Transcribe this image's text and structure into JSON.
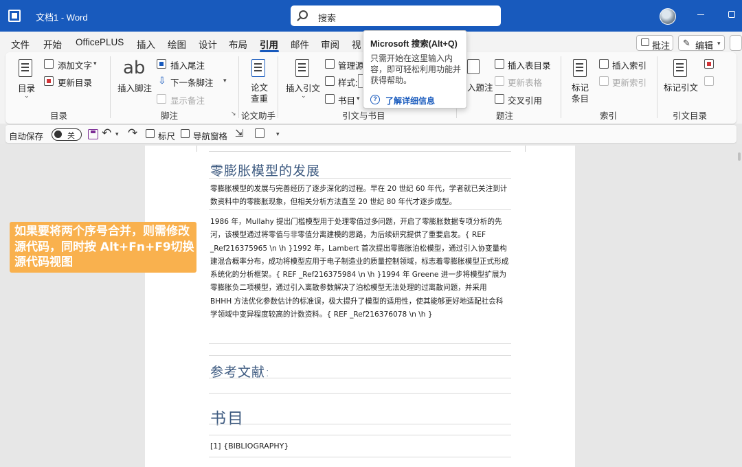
{
  "titlebar": {
    "doc_title": "文档1 - Word",
    "search_placeholder": "搜索"
  },
  "tabs": [
    "文件",
    "开始",
    "OfficePLUS",
    "插入",
    "绘图",
    "设计",
    "布局",
    "引用",
    "邮件",
    "审阅",
    "视"
  ],
  "active_tab": "引用",
  "header_buttons": {
    "comment": "批注",
    "edit": "编辑"
  },
  "ribbon": {
    "toc": {
      "big_label": "目录",
      "add_text": "添加文字",
      "update_toc": "更新目录",
      "group": "目录"
    },
    "footnotes": {
      "ab": "ab",
      "insert_footnote": "插入脚注",
      "insert_endnote": "插入尾注",
      "next_footnote": "下一条脚注",
      "show_notes": "显示备注",
      "group": "脚注"
    },
    "researcher": {
      "line1": "论文",
      "line2": "查重",
      "group": "论文助手"
    },
    "citations": {
      "insert_citation": "插入引文",
      "manage_sources": "管理源",
      "style": "样式:",
      "bibliography": "书目",
      "group": "引文与书目"
    },
    "captions": {
      "insert_caption": "入题注",
      "insert_table_figures": "插入表目录",
      "update_table": "更新表格",
      "cross_reference": "交叉引用",
      "group": "题注"
    },
    "index": {
      "mark_entry_line1": "标记",
      "mark_entry_line2": "条目",
      "insert_index": "插入索引",
      "update_index": "更新索引",
      "group": "索引"
    },
    "toa": {
      "mark_citation": "标记引文",
      "group": "引文目录"
    }
  },
  "tooltip": {
    "title": "Microsoft 搜索(Alt+Q)",
    "body": "只需开始在这里输入内容，即可轻松利用功能并获得帮助。",
    "help_glyph": "?",
    "link": "了解详细信息"
  },
  "qat": {
    "autosave": "自动保存",
    "toggle_state": "关",
    "ruler": "标尺",
    "nav_pane": "导航窗格"
  },
  "document": {
    "heading1": "零膨胀模型的发展",
    "para1": "零膨胀模型的发展与完善经历了逐步深化的过程。早在 20 世纪 60 年代，学者就已关注到计数资料中的零膨胀现象，但相关分析方法直至 20 世纪 80 年代才逐步成型。",
    "para2": "1986 年，Mullahy 提出门槛模型用于处理零值过多问题，开启了零膨胀数据专项分析的先河，该模型通过将零值与非零值分离建模的思路，为后续研究提供了重要启发。{ REF _Ref216375965 \\n \\h }1992 年，Lambert 首次提出零膨胀泊松模型，通过引入协变量构建混合概率分布，成功将模型应用于电子制造业的质量控制领域，标志着零膨胀模型正式形成系统化的分析框架。{ REF _Ref216375984 \\n \\h }1994 年 Greene 进一步将模型扩展为零膨胀负二项模型，通过引入离散参数解决了泊松模型无法处理的过离散问题，并采用 BHHH 方法优化参数估计的标准误，极大提升了模型的适用性，使其能够更好地适配社会科学领域中变异程度较高的计数资料。{ REF _Ref216376078 \\n \\h }",
    "heading_refs": "参考文献:",
    "heading_bib": "书目",
    "bib_entry": "[1]  {BIBLIOGRAPHY}"
  },
  "callout": {
    "text": "如果要将两个序号合并，则需修改源代码，同时按 Alt+Fn+F9切换源代码视图"
  },
  "colors": {
    "titlebar": "#185abd",
    "accent": "#185abd",
    "heading": "#3d5a80",
    "callout": "#f9b14e"
  }
}
